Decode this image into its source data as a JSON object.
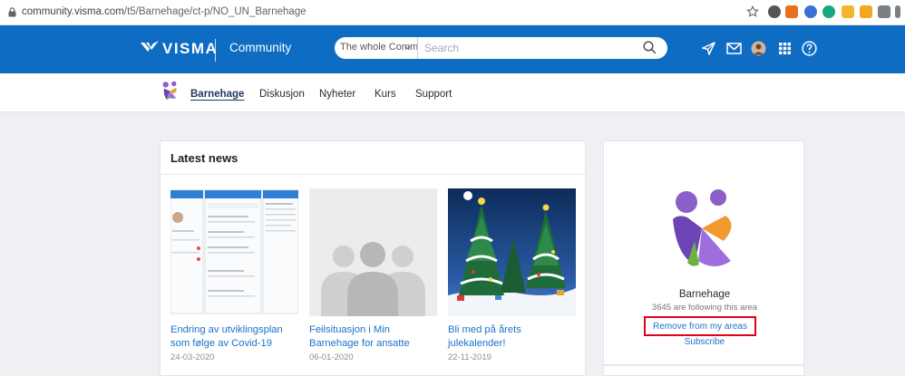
{
  "browser": {
    "url_domain": "community.visma.com",
    "url_path": "/t5/Barnehage/ct-p/NO_UN_Barnehage"
  },
  "header": {
    "brand": "VISMA",
    "section": "Community",
    "search": {
      "scope": "The whole Comm",
      "placeholder": "Search"
    }
  },
  "subnav": {
    "items": [
      {
        "label": "Barnehage",
        "active": true
      },
      {
        "label": "Diskusjon"
      },
      {
        "label": "Nyheter"
      },
      {
        "label": "Kurs"
      },
      {
        "label": "Support"
      }
    ]
  },
  "news": {
    "title": "Latest news",
    "items": [
      {
        "title": "Endring av utviklingsplan som følge av Covid-19",
        "date": "24-03-2020"
      },
      {
        "title": "Feilsituasjon i Min Barnehage for ansatte",
        "date": "06-01-2020"
      },
      {
        "title": "Bli med på årets julekalender!",
        "date": "22-11-2019"
      }
    ]
  },
  "area": {
    "name": "Barnehage",
    "followers": "3645 are following this area",
    "remove_label": "Remove from my areas",
    "subscribe_label": "Subscribe"
  },
  "colors": {
    "header_bg": "#0f6cc3",
    "link": "#1a73c8",
    "highlight_border": "#e3001b",
    "page_bg": "#eef0f4"
  }
}
